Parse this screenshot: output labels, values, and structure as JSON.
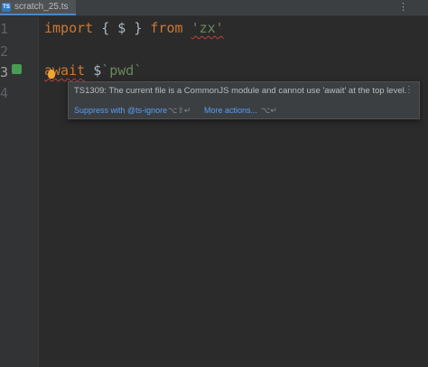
{
  "tab": {
    "label": "scratch_25.ts",
    "icon": "typescript-file-icon",
    "icon_text": "TS"
  },
  "tabbar": {
    "menu": "⋮"
  },
  "gutter": {
    "lines": [
      "1",
      "2",
      "3",
      "4"
    ]
  },
  "code": {
    "line1": {
      "import": "import",
      "brace_open": "{",
      "dollar": "$",
      "brace_close": "}",
      "from": "from",
      "module": "'zx'"
    },
    "line3": {
      "await": "await",
      "dollar": "$",
      "template": "`pwd`"
    }
  },
  "popup": {
    "message": "TS1309: The current file is a CommonJS module and cannot use 'await' at the top level.",
    "more": "⋮",
    "action1_label": "Suppress with @ts-ignore",
    "action1_shortcut": "⌥⇧↵",
    "action2_label": "More actions...",
    "action2_shortcut": "⌥↵"
  },
  "colors": {
    "background": "#2b2b2b",
    "keyword": "#cc7832",
    "string": "#6a8759",
    "link": "#589df6",
    "error_underline": "#bc3f3c"
  }
}
